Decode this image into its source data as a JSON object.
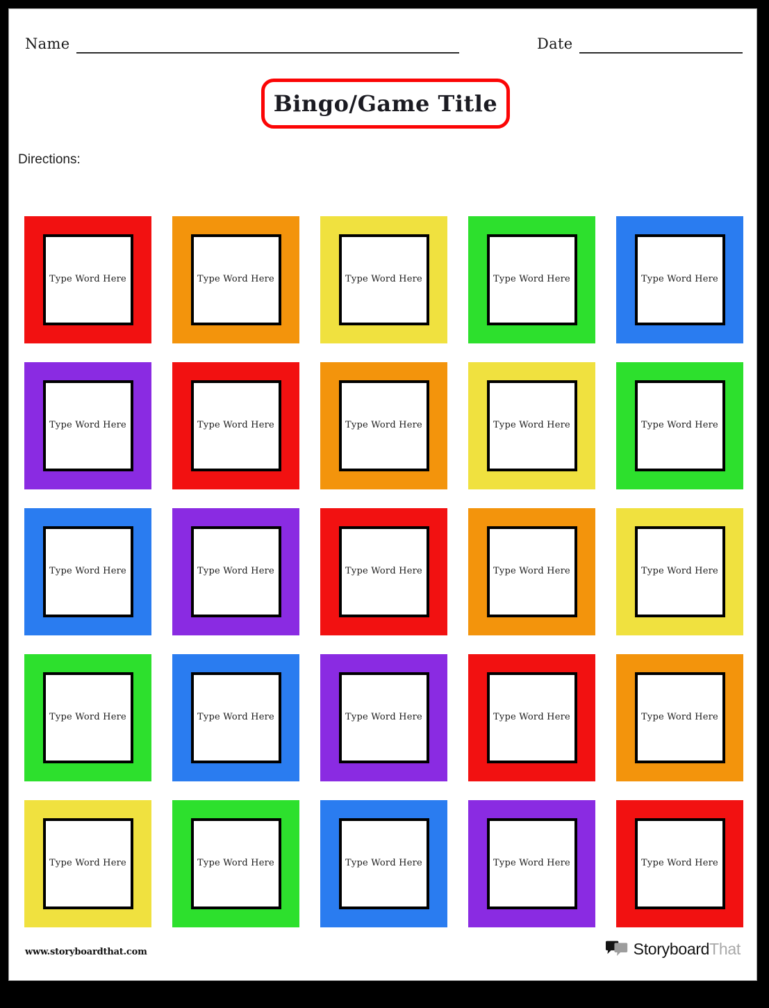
{
  "page": {
    "background_color": "#000000",
    "paper_color": "#ffffff"
  },
  "header": {
    "name_label": "Name",
    "date_label": "Date"
  },
  "title": {
    "text": "Bingo/Game Title",
    "border_color": "#FB0505"
  },
  "directions": {
    "label": "Directions:"
  },
  "palette": {
    "red": "#F21111",
    "orange": "#F3940C",
    "yellow": "#F0E13F",
    "green": "#2DE02D",
    "blue": "#2A7CF0",
    "purple": "#8A2BE2",
    "cell_border": "#000000",
    "cell_fill": "#ffffff"
  },
  "grid": {
    "rows": 5,
    "columns": 5,
    "cell_placeholder": "Type Word Here",
    "cells": [
      {
        "row": 1,
        "col": 1,
        "color": "#F21111",
        "color_name": "red",
        "text": "Type Word Here"
      },
      {
        "row": 1,
        "col": 2,
        "color": "#F3940C",
        "color_name": "orange",
        "text": "Type Word Here"
      },
      {
        "row": 1,
        "col": 3,
        "color": "#F0E13F",
        "color_name": "yellow",
        "text": "Type Word Here"
      },
      {
        "row": 1,
        "col": 4,
        "color": "#2DE02D",
        "color_name": "green",
        "text": "Type Word Here"
      },
      {
        "row": 1,
        "col": 5,
        "color": "#2A7CF0",
        "color_name": "blue",
        "text": "Type Word Here"
      },
      {
        "row": 2,
        "col": 1,
        "color": "#8A2BE2",
        "color_name": "purple",
        "text": "Type Word Here"
      },
      {
        "row": 2,
        "col": 2,
        "color": "#F21111",
        "color_name": "red",
        "text": "Type Word Here"
      },
      {
        "row": 2,
        "col": 3,
        "color": "#F3940C",
        "color_name": "orange",
        "text": "Type Word Here"
      },
      {
        "row": 2,
        "col": 4,
        "color": "#F0E13F",
        "color_name": "yellow",
        "text": "Type Word Here"
      },
      {
        "row": 2,
        "col": 5,
        "color": "#2DE02D",
        "color_name": "green",
        "text": "Type Word Here"
      },
      {
        "row": 3,
        "col": 1,
        "color": "#2A7CF0",
        "color_name": "blue",
        "text": "Type Word Here"
      },
      {
        "row": 3,
        "col": 2,
        "color": "#8A2BE2",
        "color_name": "purple",
        "text": "Type Word Here"
      },
      {
        "row": 3,
        "col": 3,
        "color": "#F21111",
        "color_name": "red",
        "text": "Type Word Here"
      },
      {
        "row": 3,
        "col": 4,
        "color": "#F3940C",
        "color_name": "orange",
        "text": "Type Word Here"
      },
      {
        "row": 3,
        "col": 5,
        "color": "#F0E13F",
        "color_name": "yellow",
        "text": "Type Word Here"
      },
      {
        "row": 4,
        "col": 1,
        "color": "#2DE02D",
        "color_name": "green",
        "text": "Type Word Here"
      },
      {
        "row": 4,
        "col": 2,
        "color": "#2A7CF0",
        "color_name": "blue",
        "text": "Type Word Here"
      },
      {
        "row": 4,
        "col": 3,
        "color": "#8A2BE2",
        "color_name": "purple",
        "text": "Type Word Here"
      },
      {
        "row": 4,
        "col": 4,
        "color": "#F21111",
        "color_name": "red",
        "text": "Type Word Here"
      },
      {
        "row": 4,
        "col": 5,
        "color": "#F3940C",
        "color_name": "orange",
        "text": "Type Word Here"
      },
      {
        "row": 5,
        "col": 1,
        "color": "#F0E13F",
        "color_name": "yellow",
        "text": "Type Word Here"
      },
      {
        "row": 5,
        "col": 2,
        "color": "#2DE02D",
        "color_name": "green",
        "text": "Type Word Here"
      },
      {
        "row": 5,
        "col": 3,
        "color": "#2A7CF0",
        "color_name": "blue",
        "text": "Type Word Here"
      },
      {
        "row": 5,
        "col": 4,
        "color": "#8A2BE2",
        "color_name": "purple",
        "text": "Type Word Here"
      },
      {
        "row": 5,
        "col": 5,
        "color": "#F21111",
        "color_name": "red",
        "text": "Type Word Here"
      }
    ]
  },
  "footer": {
    "url": "www.storyboardthat.com",
    "logo": {
      "icon": "speech-bubbles-icon",
      "word_primary": "Storyboard",
      "word_secondary": "That",
      "primary_color": "#141414",
      "secondary_color": "#a9a9a9"
    }
  }
}
